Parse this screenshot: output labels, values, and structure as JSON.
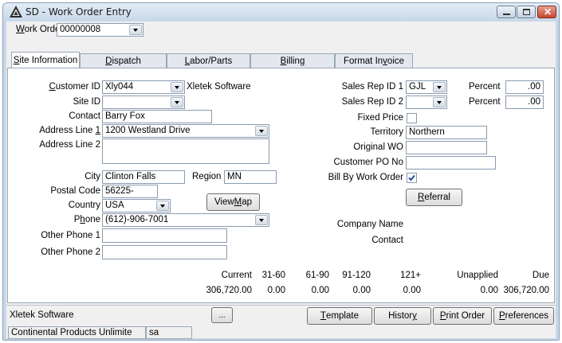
{
  "window": {
    "title": "SD - Work Order Entry"
  },
  "work_order": {
    "label": "Work Order",
    "value": "00000008"
  },
  "tabs": [
    "Site Information",
    "Dispatch",
    "Labor/Parts",
    "Billing",
    "Format Invoice"
  ],
  "left": {
    "customer_id": {
      "label": "Customer ID",
      "value": "Xly044",
      "name": "Xletek Software"
    },
    "site_id": {
      "label": "Site ID",
      "value": ""
    },
    "contact": {
      "label": "Contact",
      "value": "Barry Fox"
    },
    "address1": {
      "label": "Address Line 1",
      "value": "1200 Westland Drive"
    },
    "address2": {
      "label": "Address Line 2",
      "value": ""
    },
    "city": {
      "label": "City",
      "value": "Clinton Falls"
    },
    "region": {
      "label": "Region",
      "value": "MN"
    },
    "postal": {
      "label": "Postal Code",
      "value": "56225-"
    },
    "country": {
      "label": "Country",
      "value": "USA"
    },
    "phone": {
      "label": "Phone",
      "value": "(612)-906-7001"
    },
    "other1": {
      "label": "Other Phone 1",
      "value": ""
    },
    "other2": {
      "label": "Other Phone 2",
      "value": ""
    },
    "view_map": "View Map"
  },
  "right": {
    "rep1": {
      "label": "Sales Rep ID 1",
      "value": "GJL",
      "pct_label": "Percent",
      "pct": ".00"
    },
    "rep2": {
      "label": "Sales Rep ID 2",
      "value": "",
      "pct_label": "Percent",
      "pct": ".00"
    },
    "fixed_price": {
      "label": "Fixed Price",
      "checked": false
    },
    "territory": {
      "label": "Territory",
      "value": "Northern"
    },
    "original_wo": {
      "label": "Original WO",
      "value": ""
    },
    "po": {
      "label": "Customer PO No",
      "value": ""
    },
    "bill_by_wo": {
      "label": "Bill By Work Order",
      "checked": true
    },
    "referral": "Referral",
    "company_name": "Company Name",
    "contact": "Contact"
  },
  "aging": {
    "headers": [
      "Current",
      "31-60",
      "61-90",
      "91-120",
      "121+",
      "Unapplied",
      "Due"
    ],
    "values": [
      "306,720.00",
      "0.00",
      "0.00",
      "0.00",
      "0.00",
      "0.00",
      "306,720.00"
    ]
  },
  "footer": {
    "company": "Xletek Software",
    "ellipsis": "...",
    "template": "Template",
    "history": "History",
    "print_order": "Print Order",
    "preferences": "Preferences",
    "status_company": "Continental Products Unlimite",
    "status_user": "sa"
  }
}
